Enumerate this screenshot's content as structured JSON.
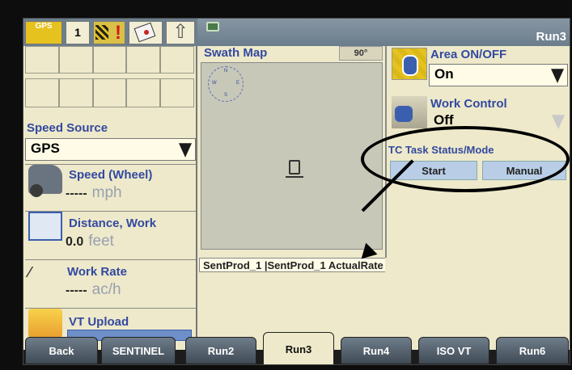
{
  "header": {
    "gps_label": "GPS",
    "one_label": "1",
    "run_title": "Run3"
  },
  "left": {
    "speed_source_label": "Speed Source",
    "speed_source_value": "GPS",
    "speed": {
      "label": "Speed (Wheel)",
      "value": "-----",
      "unit": "mph"
    },
    "distance": {
      "label": "Distance, Work",
      "value": "0.0",
      "unit": "feet"
    },
    "work_rate": {
      "label": "Work Rate",
      "value": "-----",
      "unit": "ac/h"
    },
    "vt_upload": {
      "label": "VT Upload"
    }
  },
  "center": {
    "swath_title": "Swath Map",
    "rotate_label": "90°",
    "compass": {
      "n": "N",
      "s": "S",
      "e": "E",
      "w": "W"
    },
    "sentprod_label": "SentProd_1 |SentProd_1 ActualRate"
  },
  "right": {
    "area_title": "Area ON/OFF",
    "area_value": "On",
    "work_title": "Work Control",
    "work_value": "Off",
    "tc_title": "TC Task Status/Mode",
    "start_label": "Start",
    "manual_label": "Manual"
  },
  "tabs": [
    {
      "label": "Back"
    },
    {
      "label": "SENTINEL"
    },
    {
      "label": "Run2"
    },
    {
      "label": "Run3"
    },
    {
      "label": "Run4"
    },
    {
      "label": "ISO VT"
    },
    {
      "label": "Run6"
    }
  ]
}
